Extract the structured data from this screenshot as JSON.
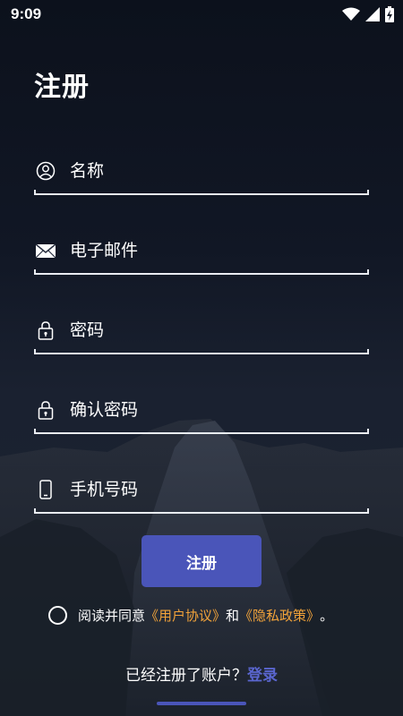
{
  "status_bar": {
    "time": "9:09",
    "icons": [
      "wifi-icon",
      "cellular-signal-icon",
      "battery-charging-icon"
    ]
  },
  "page": {
    "title": "注册"
  },
  "form": {
    "name_placeholder": "名称",
    "email_placeholder": "电子邮件",
    "password_placeholder": "密码",
    "confirm_password_placeholder": "确认密码",
    "phone_placeholder": "手机号码",
    "submit_label": "注册"
  },
  "agreement": {
    "prefix": "阅读并同意",
    "user_agreement": "《用户协议》",
    "conjunction": "和",
    "privacy_policy": "《隐私政策》",
    "suffix": "。"
  },
  "login": {
    "prompt": "已经注册了账户？",
    "link_label": "登录"
  },
  "colors": {
    "accent": "#4a55b9",
    "link_orange": "#f2a33a",
    "login_link": "#5a66cf"
  }
}
